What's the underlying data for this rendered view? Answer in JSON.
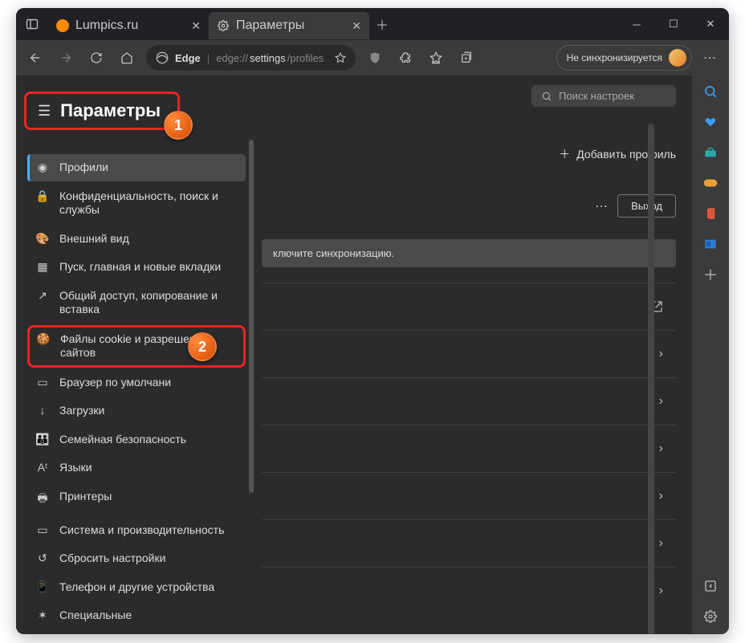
{
  "tabs": {
    "t1": "Lumpics.ru",
    "t2": "Параметры"
  },
  "url": {
    "brand": "Edge",
    "prefix": "edge://",
    "mid": "settings",
    "suffix": "/profiles"
  },
  "sync_label": "Не синхронизируется",
  "settings_title": "Параметры",
  "search_placeholder": "Поиск настроек",
  "add_profile": "Добавить профиль",
  "exit": "Выход",
  "enable_sync_hint": "ключите синхронизацию.",
  "callouts": {
    "one": "1",
    "two": "2"
  },
  "menu": [
    {
      "label": "Профили",
      "icon": "◉",
      "active": true
    },
    {
      "label": "Конфиденциальность, поиск и службы",
      "icon": "🔒"
    },
    {
      "label": "Внешний вид",
      "icon": "🎨"
    },
    {
      "label": "Пуск, главная и новые вкладки",
      "icon": "▦"
    },
    {
      "label": "Общий доступ, копирование и вставка",
      "icon": "↗"
    },
    {
      "label": "Файлы cookie и разрешения сайтов",
      "icon": "🍪",
      "highlight": true
    },
    {
      "label": "Браузер по умолчани",
      "icon": "▭"
    },
    {
      "label": "Загрузки",
      "icon": "↓"
    },
    {
      "label": "Семейная безопасность",
      "icon": "👪"
    },
    {
      "label": "Языки",
      "icon": "Aᵗ"
    },
    {
      "label": "Принтеры",
      "icon": "🖶"
    },
    {
      "label": "Система и производительность",
      "icon": "▭"
    },
    {
      "label": "Сбросить настройки",
      "icon": "↺"
    },
    {
      "label": "Телефон и другие устройства",
      "icon": "📱"
    },
    {
      "label": "Специальные",
      "icon": "✶"
    }
  ]
}
